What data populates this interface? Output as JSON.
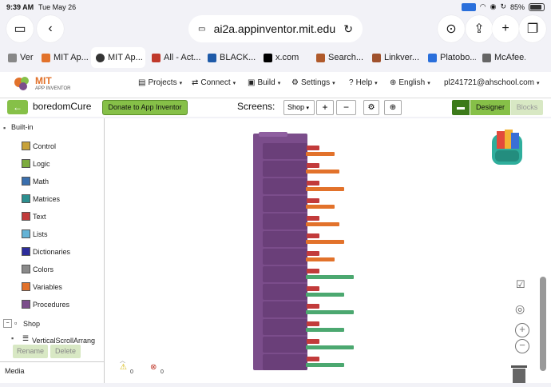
{
  "status": {
    "time": "9:39 AM",
    "date": "Tue May 26",
    "battery": "85%"
  },
  "browser": {
    "url": "ai2a.appinventor.mit.edu",
    "tabs": [
      {
        "label": "Ver",
        "color": "#888"
      },
      {
        "label": "MIT Ap...",
        "color": "#e2722b"
      },
      {
        "label": "MIT Ap...",
        "color": "#333",
        "active": true
      },
      {
        "label": "All - Act...",
        "color": "#c0392b"
      },
      {
        "label": "BLACK...",
        "color": "#1e5aa8"
      },
      {
        "label": "x.com",
        "color": "#000"
      },
      {
        "label": "Search...",
        "color": "#b05a2b"
      },
      {
        "label": "Linkver...",
        "color": "#a0522d"
      },
      {
        "label": "Platobo...",
        "color": "#2a6fdb"
      },
      {
        "label": "McAfee...",
        "color": "#666"
      }
    ]
  },
  "header": {
    "brand_top": "MIT",
    "brand_bottom": "APP INVENTOR",
    "menus": [
      "Projects",
      "Connect",
      "Build",
      "Settings",
      "Help",
      "English"
    ],
    "account": "pl241721@ahschool.com"
  },
  "toolbar": {
    "project_name": "boredomCure",
    "donate": "Donate to App Inventor",
    "screens_label": "Screens:",
    "screen_value": "Shop",
    "add": "+",
    "remove": "−",
    "designer": "Designer",
    "blocks": "Blocks"
  },
  "palette": {
    "builtin_label": "Built-in",
    "items": [
      {
        "label": "Control",
        "color": "#c7a23a"
      },
      {
        "label": "Logic",
        "color": "#7cab3e"
      },
      {
        "label": "Math",
        "color": "#3a6fae"
      },
      {
        "label": "Matrices",
        "color": "#2c8f8f"
      },
      {
        "label": "Text",
        "color": "#c23b3b"
      },
      {
        "label": "Lists",
        "color": "#64b3d6"
      },
      {
        "label": "Dictionaries",
        "color": "#2d2d9c"
      },
      {
        "label": "Colors",
        "color": "#8a8a8a"
      },
      {
        "label": "Variables",
        "color": "#e2722b"
      },
      {
        "label": "Procedures",
        "color": "#7b4d8b"
      }
    ],
    "shop_label": "Shop",
    "child_label": "VerticalScrollArrang",
    "rename": "Rename",
    "delete": "Delete",
    "media": "Media"
  },
  "canvas": {
    "warnings": "0",
    "errors": "0"
  },
  "colors": {
    "accent_green": "#86c048",
    "procedure_purple": "#7b4d8b"
  }
}
